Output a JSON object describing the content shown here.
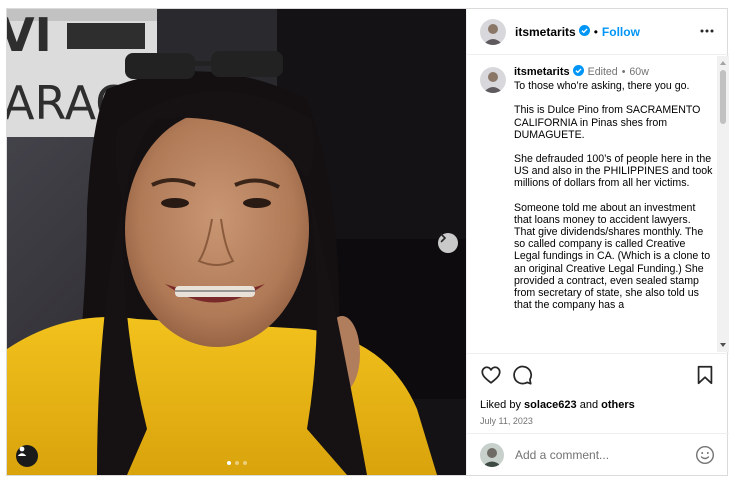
{
  "post": {
    "username": "itsmetarits",
    "follow_label": "Follow",
    "separator": "•",
    "edited": "Edited",
    "time_ago": "60w",
    "caption": [
      "To those who’re asking, there you go.",
      "This is Dulce Pino from SACRAMENTO CALIFORNIA in Pinas shes from DUMAGUETE.",
      "She defrauded 100’s of people here in the US and also in the PHILIPPINES and took millions of dollars from all her victims.",
      "Someone told me about an investment that loans money to accident lawyers. That give dividends/shares monthly. The so called company is called Creative Legal fundings in CA. (Which is a clone to an original Creative Legal Funding.) She provided a contract, even sealed stamp from secretary of state, she also told us that the company has a"
    ],
    "liked_by_prefix": "Liked by",
    "liked_by_user": "solace623",
    "liked_by_and": "and",
    "liked_by_others": "others",
    "date": "July 11, 2023",
    "comment_placeholder": "Add a comment...",
    "carousel": {
      "total": 3,
      "current": 1
    }
  },
  "media": {
    "sign_text": "VI  ARAC"
  },
  "icons": {
    "verified": "verified-badge-icon",
    "more": "more-options-icon",
    "like": "heart-icon",
    "comment": "comment-bubble-icon",
    "save": "bookmark-icon",
    "emoji": "smiley-icon",
    "next": "chevron-right-icon",
    "tags": "user-tag-icon"
  },
  "colors": {
    "accent": "#0095f6",
    "verified": "#0095f6",
    "muted": "#737373"
  }
}
